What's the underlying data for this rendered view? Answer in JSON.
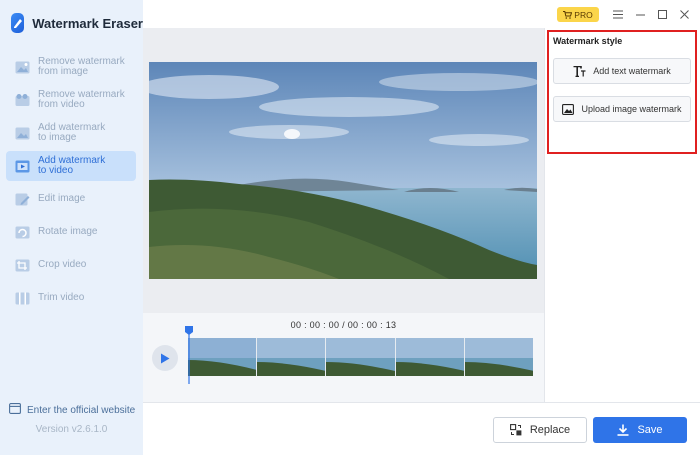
{
  "app": {
    "title": "Watermark Eraser",
    "version": "Version v2.6.1.0"
  },
  "sidebar": {
    "items": [
      {
        "label": "Remove watermark\nfrom image",
        "icon": "remove-watermark-image-icon",
        "active": false
      },
      {
        "label": "Remove watermark\nfrom video",
        "icon": "remove-watermark-video-icon",
        "active": false
      },
      {
        "label": "Add watermark\nto image",
        "icon": "add-watermark-image-icon",
        "active": false
      },
      {
        "label": "Add watermark\nto video",
        "icon": "add-watermark-video-icon",
        "active": true
      },
      {
        "label": "Edit image",
        "icon": "edit-image-icon",
        "active": false
      },
      {
        "label": "Rotate image",
        "icon": "rotate-image-icon",
        "active": false
      },
      {
        "label": "Crop video",
        "icon": "crop-video-icon",
        "active": false
      },
      {
        "label": "Trim video",
        "icon": "trim-video-icon",
        "active": false
      }
    ],
    "website_link": "Enter the official website"
  },
  "topbar": {
    "pro_label": "PRO"
  },
  "timeline": {
    "timecode": "00 : 00 : 00 / 00 : 00 : 13"
  },
  "watermark_style": {
    "title": "Watermark style",
    "add_text_label": "Add text watermark",
    "upload_image_label": "Upload image watermark"
  },
  "footer": {
    "replace_label": "Replace",
    "save_label": "Save"
  },
  "colors": {
    "accent": "#2f74e8",
    "highlight_border": "#e02020",
    "pro_badge": "#fbd54a"
  }
}
